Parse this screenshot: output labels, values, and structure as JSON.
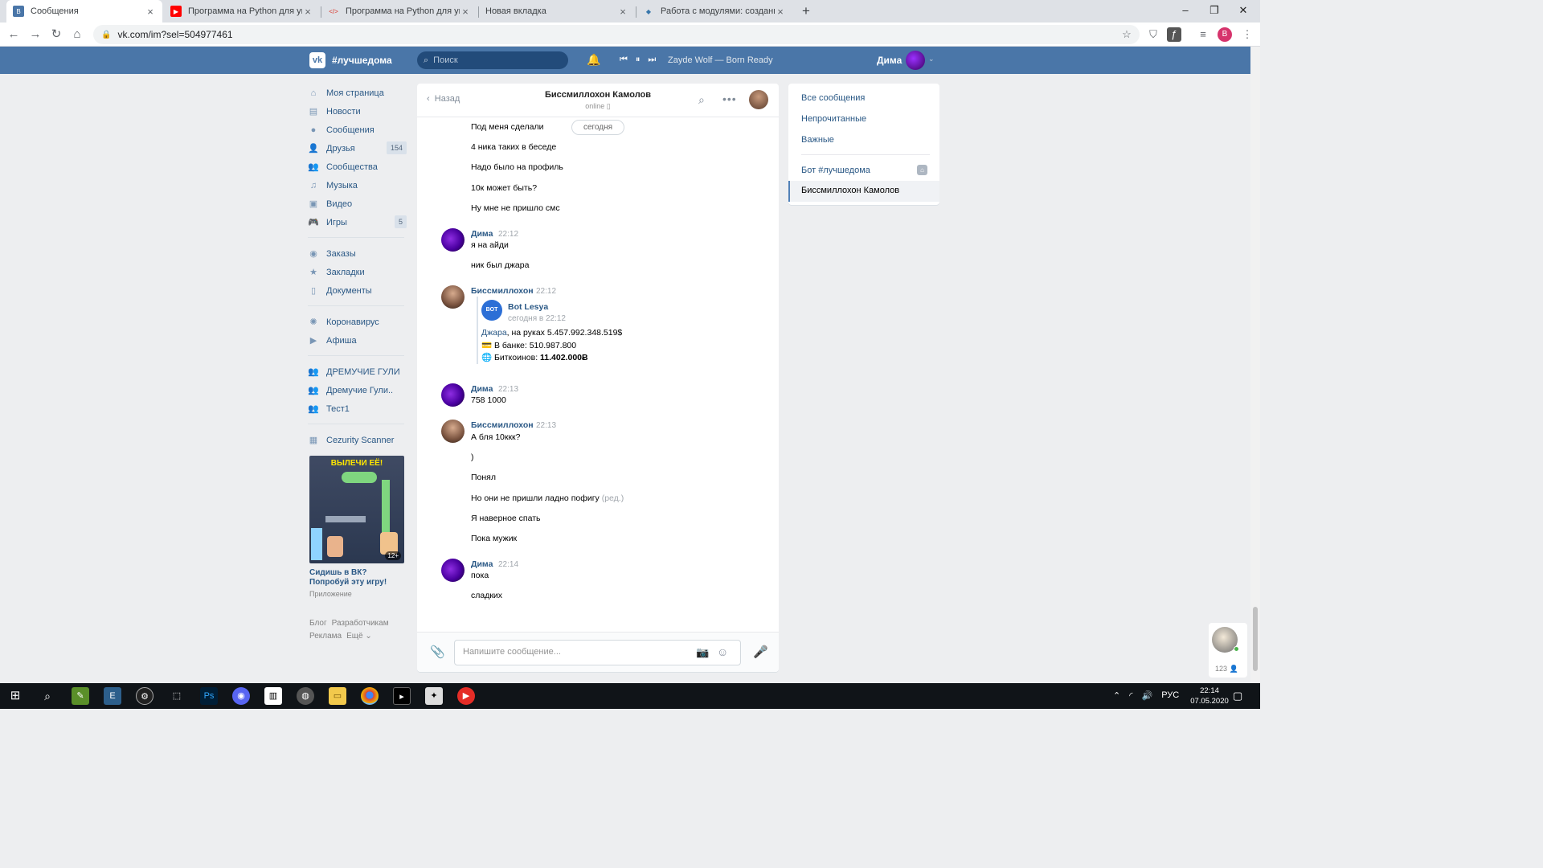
{
  "browser": {
    "tabs": [
      {
        "label": "Сообщения",
        "color": "#4a76a8",
        "glyph": "В"
      },
      {
        "label": "Программа на Python для упра",
        "color": "#ff0000",
        "glyph": "▶"
      },
      {
        "label": "Программа на Python для упра",
        "color": "#d93025",
        "glyph": "</>"
      },
      {
        "label": "Новая вкладка",
        "color": "#dee1e6",
        "glyph": ""
      },
      {
        "label": "Работа с модулями: создание, п",
        "color": "#3776ab",
        "glyph": "◆"
      }
    ],
    "new_tab": "+",
    "url": "vk.com/im?sel=504977461",
    "profile_letter": "B"
  },
  "vk": {
    "brand": "#лучшедома",
    "search_placeholder": "Поиск",
    "track": "Zayde Wolf — Born Ready",
    "user": "Дима",
    "accent": "#4a76a8"
  },
  "menu": {
    "items": [
      {
        "label": "Моя страница",
        "icon": "home-icon"
      },
      {
        "label": "Новости",
        "icon": "news-icon"
      },
      {
        "label": "Сообщения",
        "icon": "messages-icon"
      },
      {
        "label": "Друзья",
        "icon": "friends-icon",
        "badge": "154"
      },
      {
        "label": "Сообщества",
        "icon": "groups-icon"
      },
      {
        "label": "Музыка",
        "icon": "music-icon"
      },
      {
        "label": "Видео",
        "icon": "video-icon"
      },
      {
        "label": "Игры",
        "icon": "games-icon",
        "badge": "5"
      },
      {
        "label": "Заказы",
        "icon": "orders-icon"
      },
      {
        "label": "Закладки",
        "icon": "bookmarks-icon"
      },
      {
        "label": "Документы",
        "icon": "documents-icon"
      },
      {
        "label": "Коронавирус",
        "icon": "virus-icon"
      },
      {
        "label": "Афиша",
        "icon": "events-icon"
      },
      {
        "label": "ДРЕМУЧИЕ ГУЛИ",
        "icon": "group-icon"
      },
      {
        "label": "Дремучие Гули..",
        "icon": "group-icon"
      },
      {
        "label": "Тест1",
        "icon": "group-icon"
      },
      {
        "label": "Cezurity Scanner",
        "icon": "app-icon"
      }
    ],
    "ad": {
      "image_title": "ВЫЛЕЧИ ЕЁ!",
      "age": "12+",
      "text": "Сидишь в ВК? Попробуй эту игру!",
      "sub": "Приложение"
    },
    "footer": [
      "Блог",
      "Разработчикам",
      "Реклама",
      "Ещё ⌄"
    ]
  },
  "chat": {
    "back": "Назад",
    "name": "Биссмиллохон Камолов",
    "status": "online",
    "date_pill": "сегодня",
    "messages": [
      {
        "text": "Под меня сделали"
      },
      {
        "text": "4 ника таких в беседе"
      },
      {
        "text": "Надо было на профиль"
      },
      {
        "text": "10к может быть?"
      },
      {
        "text": "Ну мне не пришло смс"
      },
      {
        "sender": "Дима",
        "time": "22:12",
        "text": "я на айди"
      },
      {
        "text": "ник был джара"
      },
      {
        "sender": "Биссмиллохон",
        "time": "22:12"
      },
      {
        "sender": "Дима",
        "time": "22:13",
        "text": "758 1000"
      },
      {
        "sender": "Биссмиллохон",
        "time": "22:13",
        "text": "А бля 10ккк?"
      },
      {
        "text": ")"
      },
      {
        "text": "Понял"
      },
      {
        "text": "Но они не пришли ладно пофигу",
        "edited": "(ред.)"
      },
      {
        "text": "Я наверное спать"
      },
      {
        "text": "Пока мужик"
      },
      {
        "sender": "Дима",
        "time": "22:14",
        "text": "пока"
      },
      {
        "text": "сладких"
      }
    ],
    "forward": {
      "logo": "BOT LESYA",
      "name": "Bot Lesya",
      "date": "сегодня в 22:12",
      "link": "Джара",
      "line1": ", на руках 5.457.992.348.519$",
      "line2": "💳 В банке: 510.987.800",
      "line3_prefix": "🌐 Биткоинов: ",
      "line3_value": "11.402.000Ƀ"
    },
    "input_placeholder": "Напишите сообщение..."
  },
  "right": {
    "all": "Все сообщения",
    "unread": "Непрочитанные",
    "important": "Важные",
    "bot": "Бот #лучшедома",
    "active": "Биссмиллохон Камолов"
  },
  "corner": {
    "count": "123 👤"
  },
  "taskbar": {
    "lang": "РУС",
    "time": "22:14",
    "date": "07.05.2020"
  }
}
